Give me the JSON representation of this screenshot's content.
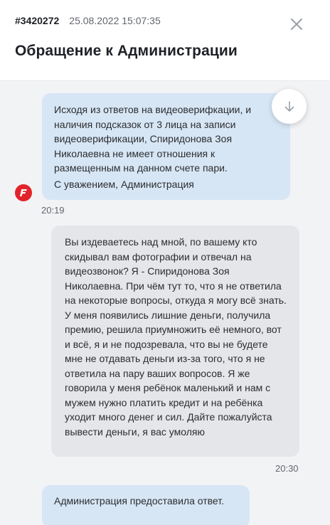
{
  "header": {
    "ticket_id": "#3420272",
    "date": "25.08.2022 15:07:35",
    "title": "Обращение к Администрации"
  },
  "messages": [
    {
      "author": "admin",
      "text": "Исходя из ответов на видеоверифкации, и наличия подсказок от 3 лица на записи видеоверификации, Спиридонова Зоя Николаевна не имеет отношения к размещенным на данном счете пари.",
      "signature": "С уважением, Администрация",
      "time": "20:19"
    },
    {
      "author": "user",
      "text": "Вы издеваетесь над мной, по вашему кто скидывал вам фотографии и отвечал на видеозвонок? Я - Спиридонова Зоя Николаевна. При чём тут то, что я не ответила на некоторые вопросы, откуда я могу всё знать. У меня появились лишние деньги, получила премию, решила приумножить её немного, вот и всё, я и не подозревала, что вы не будете мне не отдавать деньги из-за того, что я не ответила на пару ваших вопросов. Я же говорила у меня ребёнок маленький и нам с мужем нужно платить кредит и на ребёнка уходит много денег и сил. Дайте пожалуйста вывести деньги, я вас умоляю",
      "time": "20:30"
    },
    {
      "author": "admin",
      "text": "Администрация предоставила ответ."
    }
  ],
  "icons": {
    "close": "close-icon",
    "scroll_down": "arrow-down-icon",
    "avatar": "brand-f-logo"
  },
  "colors": {
    "admin_bubble": "#d7e6f4",
    "user_bubble": "#e5e6ea",
    "brand": "#e2232a",
    "background": "#f2f3f5"
  }
}
